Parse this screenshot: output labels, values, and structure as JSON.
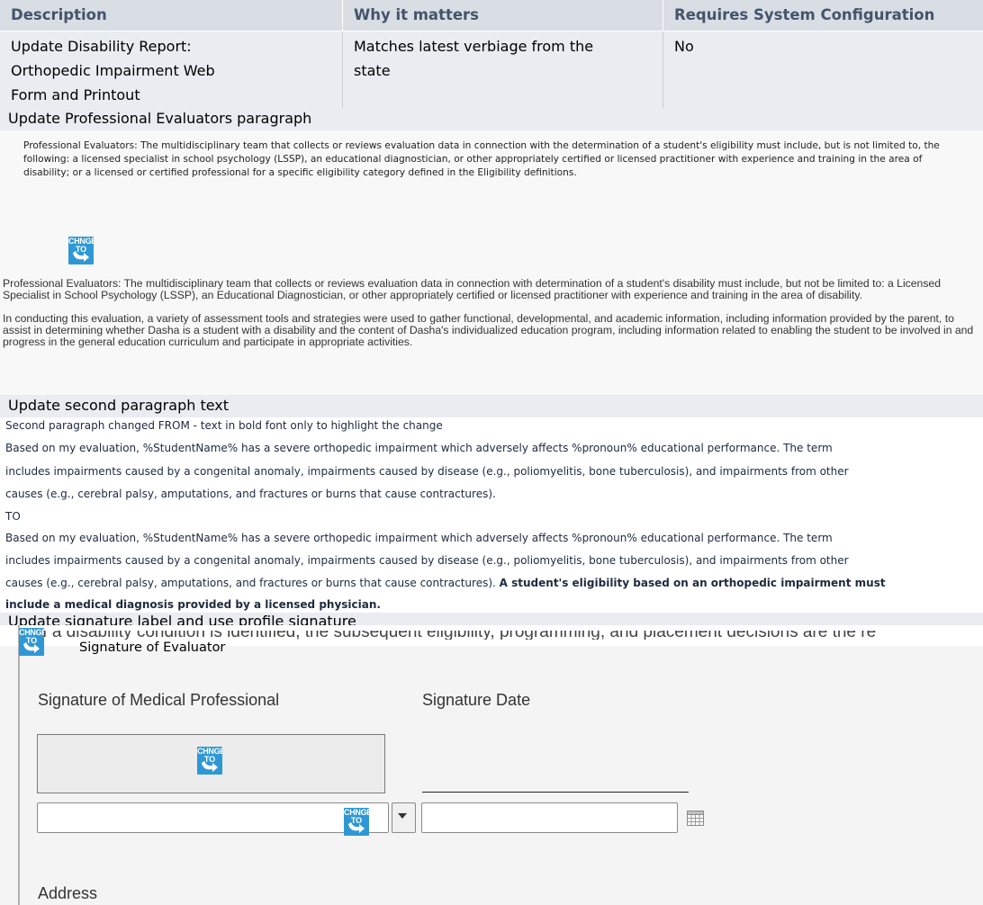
{
  "table": {
    "headers": [
      "Description",
      "Why it matters",
      "Requires System Configuration"
    ],
    "row": {
      "description_lines": [
        "Update Disability Report:",
        "Orthopedic Impairment Web",
        "Form and Printout"
      ],
      "why_lines": [
        "Matches latest verbiage from the",
        "state"
      ],
      "config": "No"
    }
  },
  "sections": [
    "Update Professional Evaluators paragraph",
    "Update second paragraph text",
    "Update signature label and use profile signature"
  ],
  "change_icon": {
    "line1": "CHNGE",
    "line2": "TO",
    "icon": "change-to-arrow-icon"
  },
  "evaluators": {
    "old_paragraph": "Professional Evaluators: The multidisciplinary team that collects or reviews evaluation data in connection with the determination of a student's eligibility must include, but is not limited to, the following: a licensed specialist in school psychology (LSSP), an educational diagnostician, or other appropriately certified or licensed practitioner with experience and training in the area of disability; or a licensed or certified professional for a specific eligibility category defined in the Eligibility definitions.",
    "new_paragraph_1": "Professional Evaluators: The multidisciplinary team that collects or reviews evaluation data in connection with determination of a student's disability must include, but not be limited to: a Licensed Specialist in School Psychology (LSSP), an Educational Diagnostician, or other appropriately certified or licensed practitioner with experience and training in the area of disability.",
    "new_paragraph_2": "In conducting this evaluation, a variety of assessment tools and strategies were used to gather functional, developmental, and academic information, including information provided by the parent, to assist in determining whether Dasha is a student with a disability and the content of Dasha's individualized education program, including information related to enabling the student to be involved in and progress in the general education curriculum and participate in appropriate activities."
  },
  "second_paragraph": {
    "intro": "Second paragraph changed FROM - text in bold font only to highlight the change",
    "from_lines": [
      "Based on my evaluation, %StudentName% has a severe orthopedic impairment which adversely affects %pronoun% educational performance. The term",
      "includes impairments caused by a congenital anomaly, impairments caused by disease (e.g., poliomyelitis, bone tuberculosis), and impairments from other",
      "causes (e.g., cerebral palsy, amputations, and fractures or burns that cause contractures)."
    ],
    "to_label": "TO",
    "to_lines": [
      "Based on my evaluation, %StudentName% has a severe orthopedic impairment which adversely affects %pronoun% educational performance. The term",
      "includes impairments caused by a congenital anomaly, impairments caused by disease (e.g., poliomyelitis, bone tuberculosis), and impairments from other"
    ],
    "to_line3_plain": "causes (e.g., cerebral palsy, amputations, and fractures or burns that cause contractures). ",
    "to_line3_bold": "A student's eligibility based on an orthopedic impairment must",
    "to_line4_bold": "include a medical diagnosis provided by a licensed physician."
  },
  "signature": {
    "truncated_text": "If a disability condition is identified, the subsequent eligibility, programming, and placement decisions are the re",
    "old_label": "Signature of Evaluator",
    "medical_label": "Signature of Medical Professional",
    "date_label": "Signature Date",
    "address_label": "Address",
    "name_input_value": "",
    "date_input_value": ""
  }
}
